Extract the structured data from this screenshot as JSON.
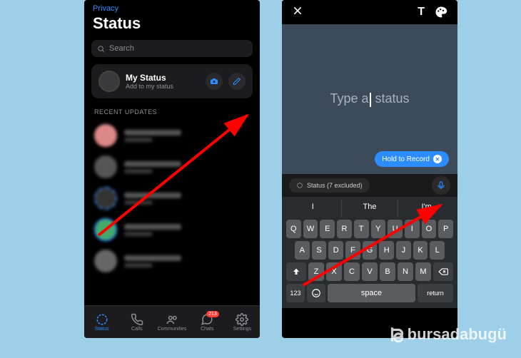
{
  "left": {
    "privacy": "Privacy",
    "title": "Status",
    "search_placeholder": "Search",
    "my_status": {
      "title": "My Status",
      "sub": "Add to my status"
    },
    "section": "RECENT UPDATES",
    "updates_count": 5,
    "tabs": [
      {
        "label": "Status"
      },
      {
        "label": "Calls"
      },
      {
        "label": "Communities"
      },
      {
        "label": "Chats",
        "badge": "213"
      },
      {
        "label": "Settings"
      }
    ]
  },
  "right": {
    "placeholder_a": "Type a",
    "placeholder_b": " status",
    "hold": "Hold to Record",
    "privacy_pill": "Status (7 excluded)",
    "suggestions": [
      "I",
      "The",
      "I'm"
    ],
    "rows": {
      "r1": [
        "Q",
        "W",
        "E",
        "R",
        "T",
        "Y",
        "U",
        "I",
        "O",
        "P"
      ],
      "r2": [
        "A",
        "S",
        "D",
        "F",
        "G",
        "H",
        "J",
        "K",
        "L"
      ],
      "r3": [
        "Z",
        "X",
        "C",
        "V",
        "B",
        "N",
        "M"
      ],
      "num": "123",
      "space": "space",
      "ret": "return"
    }
  },
  "watermark": "bursadabugü"
}
